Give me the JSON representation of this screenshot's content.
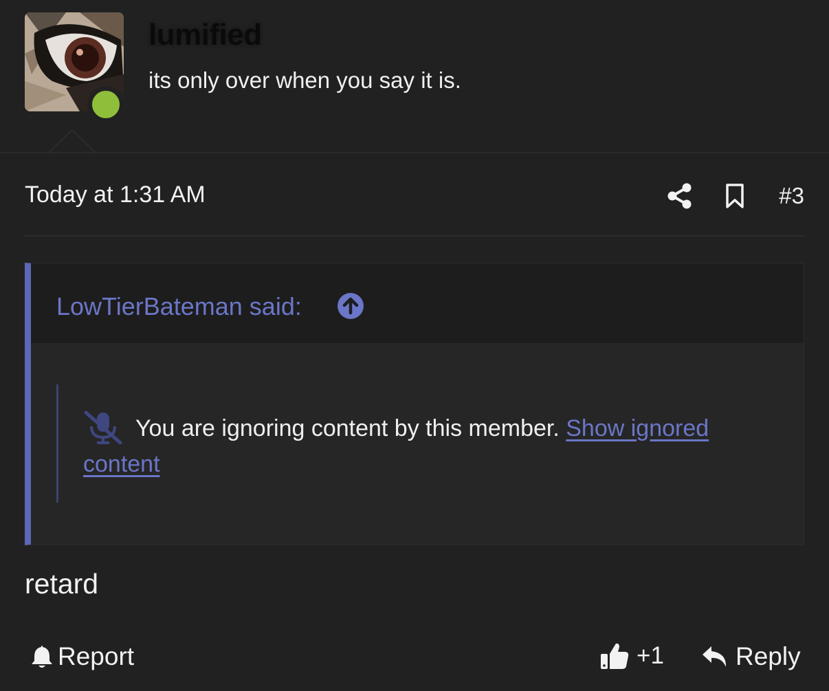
{
  "user": {
    "name": "lumified",
    "title": "its only over when you say it is.",
    "online": true,
    "status_color": "#8fbf3a"
  },
  "post": {
    "date": "Today at 1:31 AM",
    "number": "#3",
    "body": "retard"
  },
  "quote": {
    "author_line": "LowTierBateman said:",
    "ignored_message": "You are ignoring content by this member.",
    "show_link": "Show ignored content",
    "accent_color": "#5c67b8"
  },
  "actions": {
    "report": "Report",
    "like_count": "+1",
    "reply": "Reply"
  },
  "icons": {
    "share": "share-icon",
    "bookmark": "bookmark-icon",
    "jump": "arrow-up-circle-icon",
    "muted": "microphone-slash-icon",
    "report": "bell-icon",
    "like": "thumbs-up-icon",
    "reply": "reply-arrow-icon"
  }
}
